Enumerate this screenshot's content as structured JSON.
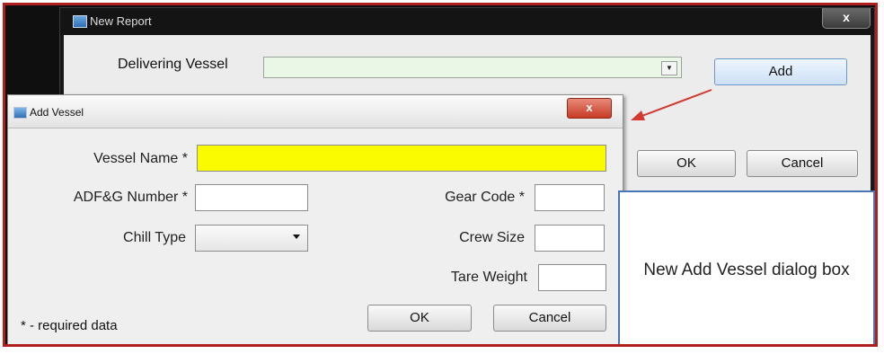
{
  "new_report": {
    "title": "New Report",
    "close_label": "x",
    "delivering_vessel_label": "Delivering Vessel",
    "delivering_vessel_value": "",
    "add_button": "Add",
    "ok_button": "OK",
    "cancel_button": "Cancel"
  },
  "add_vessel": {
    "title": "Add Vessel",
    "close_label": "x",
    "vessel_name_label": "Vessel Name *",
    "vessel_name_value": "",
    "adfg_number_label": "ADF&G Number *",
    "adfg_number_value": "",
    "gear_code_label": "Gear Code *",
    "gear_code_value": "",
    "chill_type_label": "Chill Type",
    "chill_type_value": "",
    "crew_size_label": "Crew Size",
    "crew_size_value": "",
    "tare_weight_label": "Tare Weight",
    "tare_weight_value": "",
    "required_note": "* - required data",
    "ok_button": "OK",
    "cancel_button": "Cancel"
  },
  "annotation": {
    "text": "New Add Vessel dialog box",
    "arrow_color": "#d23a32",
    "border_color": "#4a77b4"
  },
  "colors": {
    "frame_border": "#b01e1e",
    "required_field": "#fbfb00",
    "delivering_vessel_bg": "#eaf6e6"
  }
}
